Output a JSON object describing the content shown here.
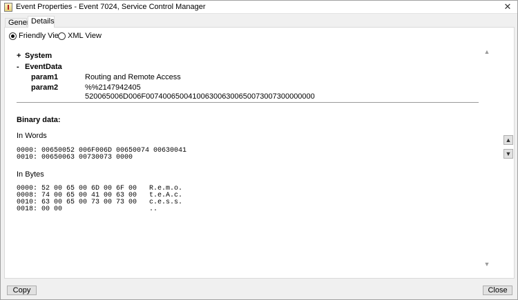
{
  "window": {
    "title": "Event Properties - Event 7024, Service Control Manager",
    "close_glyph": "✕"
  },
  "tabs": [
    {
      "label": "General",
      "active": false
    },
    {
      "label": "Details",
      "active": true
    }
  ],
  "view_options": [
    {
      "label": "Friendly View",
      "checked": true
    },
    {
      "label": "XML View",
      "checked": false
    }
  ],
  "details": {
    "system": {
      "toggle": "+",
      "label": "System"
    },
    "event_data": {
      "toggle": "-",
      "label": "EventData",
      "params": [
        {
          "name": "param1",
          "value": "Routing and Remote Access"
        },
        {
          "name": "param2",
          "value": "%%2147942405"
        },
        {
          "name": "",
          "value": "520065006D006F0074006500410063006300650073007300000000"
        }
      ]
    },
    "binary_data_label": "Binary data:",
    "in_words_label": "In Words",
    "in_words_lines": [
      "0000: 00650052 006F006D 00650074 00630041",
      "0010: 00650063 00730073 0000"
    ],
    "in_bytes_label": "In Bytes",
    "in_bytes_lines": [
      "0000: 52 00 65 00 6D 00 6F 00   R.e.m.o.",
      "0008: 74 00 65 00 41 00 63 00   t.e.A.c.",
      "0010: 63 00 65 00 73 00 73 00   c.e.s.s.",
      "0018: 00 00                     .."
    ]
  },
  "scrollbar": {
    "up_glyph": "▲",
    "down_glyph": "▼"
  },
  "navigation": {
    "previous_glyph": "▲",
    "next_glyph": "▼"
  },
  "buttons": {
    "copy_label": "Copy",
    "close_label": "Close"
  },
  "colors": {
    "window_bg": "#f0f0f0",
    "panel_bg": "#ffffff",
    "button_bg": "#e1e1e1",
    "border": "#adadad"
  }
}
